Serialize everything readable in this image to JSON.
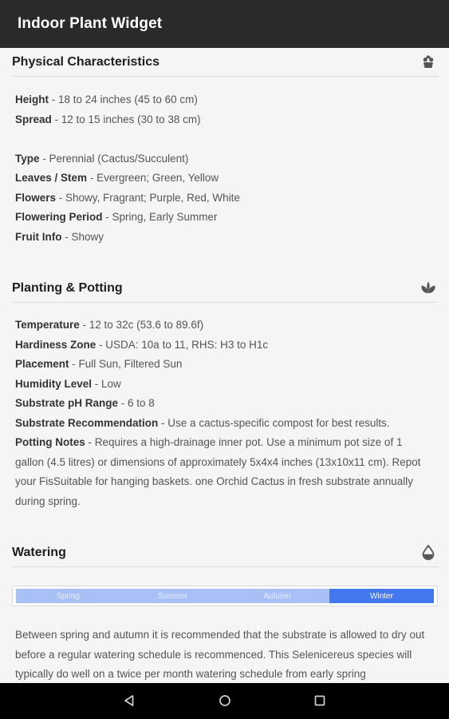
{
  "app": {
    "title": "Indoor Plant Widget"
  },
  "physical": {
    "title": "Physical Characteristics",
    "icon": "plant-pot-icon",
    "rows": [
      {
        "key": "Height",
        "value": "18 to 24 inches (45 to 60 cm)"
      },
      {
        "key": "Spread",
        "value": "12 to 15 inches (30 to 38 cm)"
      },
      {
        "key": "Type",
        "value": "Perennial (Cactus/Succulent)"
      },
      {
        "key": "Leaves / Stem",
        "value": "Evergreen; Green, Yellow"
      },
      {
        "key": "Flowers",
        "value": "Showy, Fragrant; Purple, Red, White"
      },
      {
        "key": "Flowering Period",
        "value": "Spring, Early Summer"
      },
      {
        "key": "Fruit Info",
        "value": "Showy"
      }
    ]
  },
  "planting": {
    "title": "Planting & Potting",
    "icon": "seedling-icon",
    "rows": [
      {
        "key": "Temperature",
        "value": "12 to 32c (53.6 to 89.6f)"
      },
      {
        "key": "Hardiness Zone",
        "value": "USDA: 10a to 11, RHS: H3 to H1c"
      },
      {
        "key": "Placement",
        "value": "Full Sun, Filtered Sun"
      },
      {
        "key": "Humidity Level",
        "value": "Low"
      },
      {
        "key": "Substrate pH Range",
        "value": "6 to 8"
      },
      {
        "key": "Substrate Recommendation",
        "value": "Use a cactus-specific compost for best results."
      },
      {
        "key": "Potting Notes",
        "value": "Requires a high-drainage inner pot. Use a minimum pot size of 1 gallon (4.5 litres) or dimensions of approximately 5x4x4 inches (13x10x11 cm). Repot your FisSuitable for hanging baskets. one Orchid Cactus in fresh substrate annually during spring."
      }
    ]
  },
  "watering": {
    "title": "Watering",
    "icon": "water-drop-icon",
    "seasons": [
      "Spring",
      "Summer",
      "Autumn",
      "Winter"
    ],
    "selected_season": "Winter",
    "text": "Between spring and autumn it is recommended that the substrate is allowed to dry out before a regular watering schedule is recommenced. This Selenicereus species will typically do well on a twice per month watering schedule from early spring"
  },
  "colors": {
    "appbar": "#2a2a2a",
    "season_active": "#4378f0",
    "season_inactive": "#a8c0f6"
  },
  "nav": {
    "icons": [
      "back-icon",
      "home-icon",
      "recents-icon"
    ]
  }
}
